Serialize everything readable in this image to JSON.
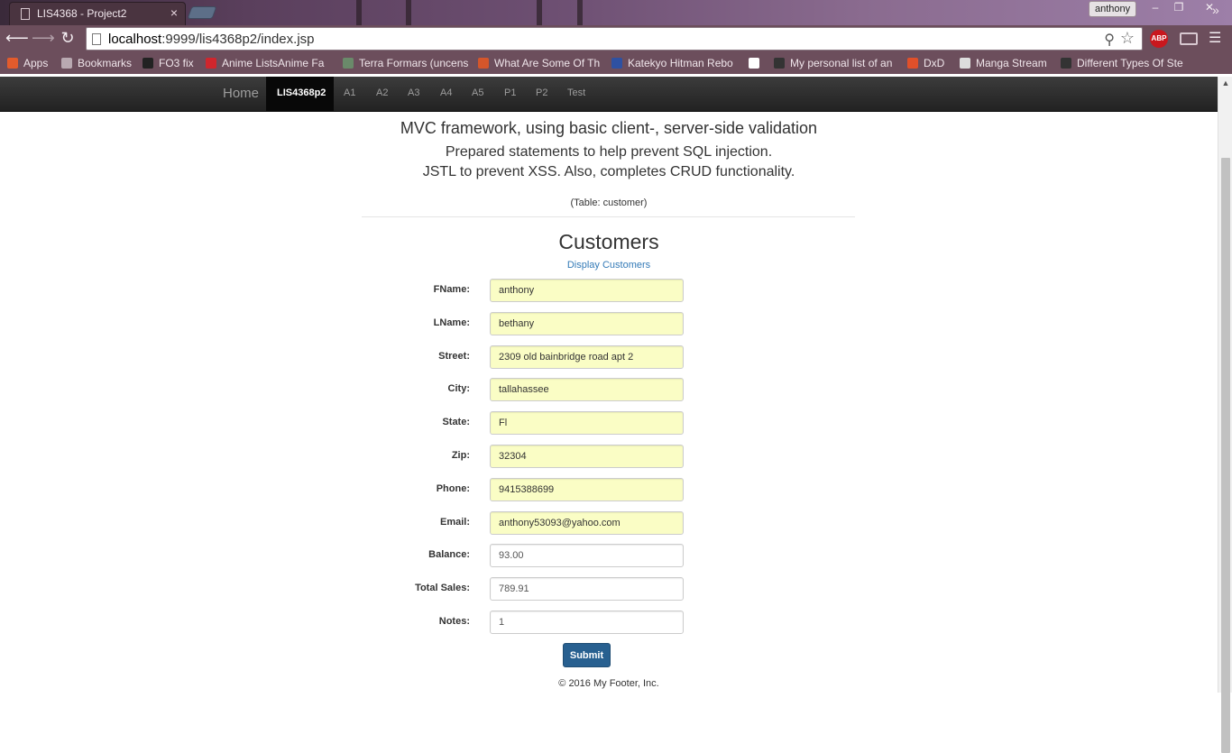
{
  "browser": {
    "tab_title": "LIS4368 - Project2",
    "tab_close": "×",
    "profile_name": "anthony",
    "window_controls": [
      "–",
      "❐",
      "✕"
    ],
    "url_host": "localhost",
    "url_path": ":9999/lis4368p2/index.jsp",
    "abp_label": "ABP",
    "bookmarks": [
      {
        "label": "Apps",
        "icon_color": "#e25b2c"
      },
      {
        "label": "Bookmarks",
        "icon_color": "#b9a9b1"
      },
      {
        "label": "FO3 fix",
        "icon_color": "#222222"
      },
      {
        "label": "Anime ListsAnime Fa",
        "icon_color": "#d0262d"
      },
      {
        "label": "Terra Formars (uncens",
        "icon_color": "#6a8a6a"
      },
      {
        "label": "What Are Some Of Th",
        "icon_color": "#d4562b"
      },
      {
        "label": "Katekyo Hitman Rebo",
        "icon_color": "#2e51a2"
      },
      {
        "label": "",
        "icon_color": "#ffffff"
      },
      {
        "label": "My personal list of an",
        "icon_color": "#333333"
      },
      {
        "label": "DxD",
        "icon_color": "#e0502a"
      },
      {
        "label": "Manga Stream",
        "icon_color": "#dddddd"
      },
      {
        "label": "Different Types Of Ste",
        "icon_color": "#333333"
      }
    ],
    "more_bookmarks": "»"
  },
  "navbar": {
    "brand": "Home",
    "items": [
      "LIS4368p2",
      "A1",
      "A2",
      "A3",
      "A4",
      "A5",
      "P1",
      "P2",
      "Test"
    ],
    "active_index": 0
  },
  "page": {
    "heading": "MVC framework, using basic client-, server-side validation",
    "sub1": "Prepared statements to help prevent SQL injection.",
    "sub2": "JSTL to prevent XSS. Also, completes CRUD functionality.",
    "table_note": "(Table: customer)",
    "title": "Customers",
    "display_link": "Display Customers",
    "fields": [
      {
        "label": "FName:",
        "value": "anthony",
        "autofill": true
      },
      {
        "label": "LName:",
        "value": "bethany",
        "autofill": true
      },
      {
        "label": "Street:",
        "value": "2309 old bainbridge road apt 2",
        "autofill": true
      },
      {
        "label": "City:",
        "value": "tallahassee",
        "autofill": true
      },
      {
        "label": "State:",
        "value": "Fl",
        "autofill": true
      },
      {
        "label": "Zip:",
        "value": "32304",
        "autofill": true
      },
      {
        "label": "Phone:",
        "value": "9415388699",
        "autofill": true
      },
      {
        "label": "Email:",
        "value": "anthony53093@yahoo.com",
        "autofill": true
      },
      {
        "label": "Balance:",
        "value": "93.00",
        "autofill": false
      },
      {
        "label": "Total Sales:",
        "value": "789.91",
        "autofill": false
      },
      {
        "label": "Notes:",
        "value": "1",
        "autofill": false
      }
    ],
    "submit_label": "Submit",
    "footer": "© 2016 My Footer, Inc."
  },
  "colors": {
    "autofill_bg": "#fafdc5",
    "link": "#337ab7",
    "primary_button": "#286090",
    "navbar_bg": "#222222"
  }
}
